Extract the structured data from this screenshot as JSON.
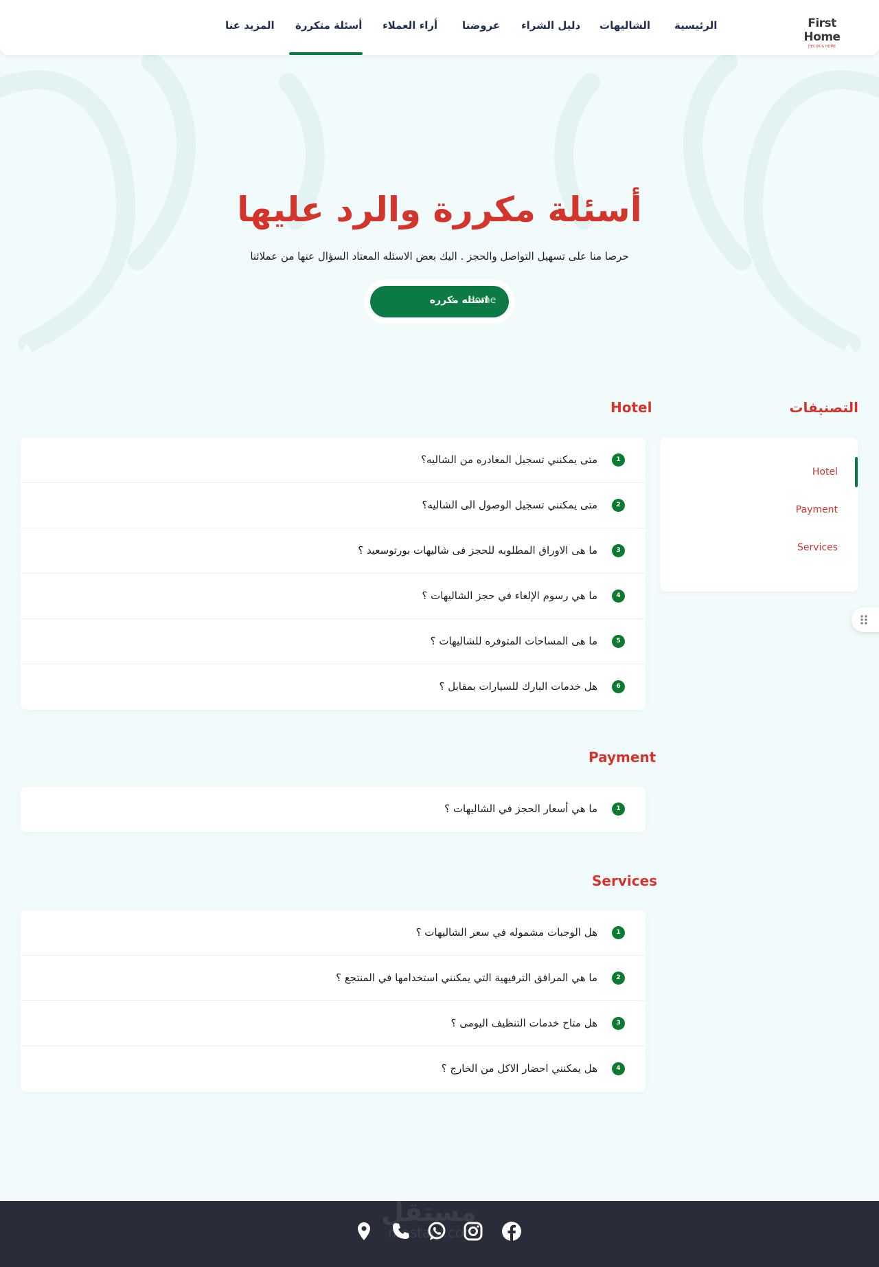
{
  "brand": {
    "title": "First Home",
    "subtitle": "DECOR & HOME"
  },
  "nav": {
    "items": [
      {
        "label": "الرئيسية"
      },
      {
        "label": "الشاليهات"
      },
      {
        "label": "دليل الشراء"
      },
      {
        "label": "عروضنا"
      },
      {
        "label": "أراء العملاء"
      },
      {
        "label": "أسئلة متكررة"
      },
      {
        "label": "المزيد عنا"
      }
    ],
    "active": "أسئلة متكررة"
  },
  "hero": {
    "title": "أسئلة مكررة والرد عليها",
    "subtitle": "حرصا منا على تسهيل التواصل والحجز . اليك بعض الاسئله المعتاد السؤال عنها من عملائنا",
    "breadcrumb": {
      "home": "Home",
      "separator": "‹",
      "current": "اسئله مكرره"
    }
  },
  "sidebar": {
    "heading": "التصنيفات",
    "items": [
      {
        "label": "Hotel"
      },
      {
        "label": "Payment"
      },
      {
        "label": "Services"
      }
    ],
    "active": "Hotel"
  },
  "sections": [
    {
      "title": "Hotel",
      "questions": [
        {
          "num": "1",
          "text": "متى يمكنني تسجيل المغادره من الشاليه؟"
        },
        {
          "num": "2",
          "text": "متى يمكنني تسجيل الوصول الى الشاليه؟"
        },
        {
          "num": "3",
          "text": "ما هى الاوراق المطلوبه للحجز فى شاليهات بورتوسعيد ؟"
        },
        {
          "num": "4",
          "text": "ما هي رسوم الإلغاء في حجز الشاليهات ؟"
        },
        {
          "num": "5",
          "text": "ما هى المساحات المتوفره للشاليهات ؟"
        },
        {
          "num": "6",
          "text": "هل خدمات البارك للسيارات بمقابل ؟"
        }
      ]
    },
    {
      "title": "Payment",
      "questions": [
        {
          "num": "1",
          "text": "ما هي أسعار الحجز في الشاليهات ؟"
        }
      ]
    },
    {
      "title": "Services",
      "questions": [
        {
          "num": "1",
          "text": "هل الوجبات مشموله في سعر الشاليهات ؟"
        },
        {
          "num": "2",
          "text": "ما هي المرافق الترفيهية التي يمكنني استخدامها في المنتجع ؟"
        },
        {
          "num": "3",
          "text": "هل متاح خدمات التنظيف اليومى ؟"
        },
        {
          "num": "4",
          "text": "هل يمكنني احضار الاكل من الخارج ؟"
        }
      ]
    }
  ],
  "footer": {
    "social": [
      {
        "icon": "location-icon"
      },
      {
        "icon": "phone-icon"
      },
      {
        "icon": "whatsapp-icon"
      },
      {
        "icon": "instagram-icon"
      },
      {
        "icon": "facebook-icon"
      }
    ],
    "watermark": "مستقل",
    "watermark_sub": "mostaql.com"
  },
  "colors": {
    "accent": "#0c7a45",
    "heading": "#d3352c",
    "page_bg": "#f1fbfb",
    "footer_bg": "#2a2d39"
  }
}
